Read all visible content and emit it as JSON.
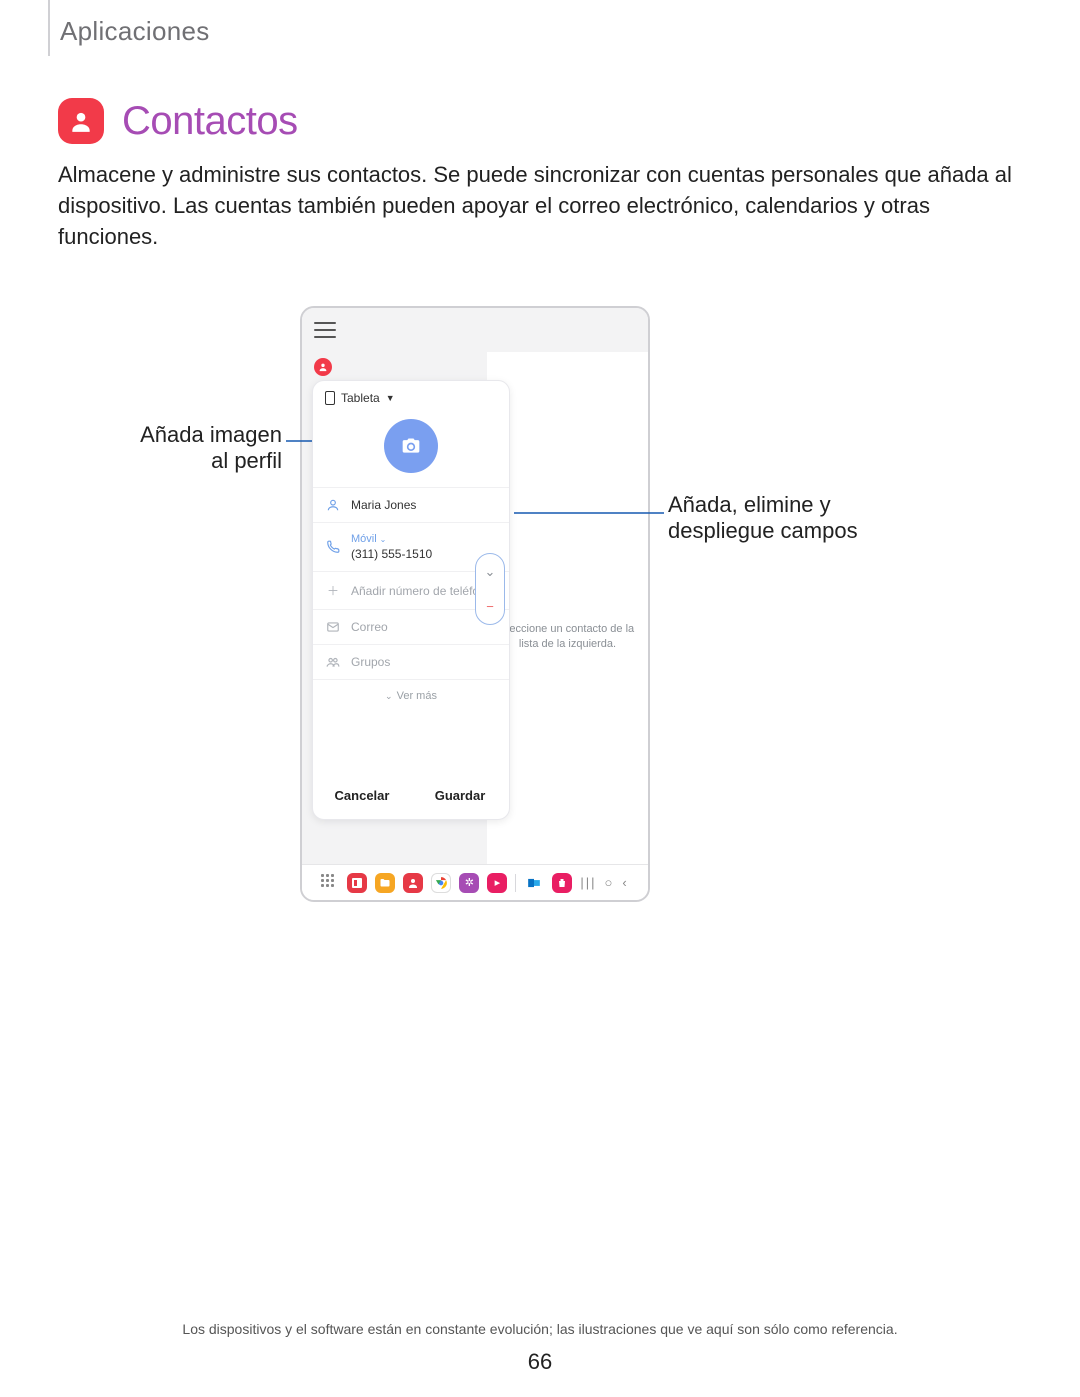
{
  "section": "Aplicaciones",
  "heading": "Contactos",
  "description": "Almacene y administre sus contactos. Se puede sincronizar con cuentas personales que añada al dispositivo. Las cuentas también pueden apoyar el correo electrónico, calendarios y otras funciones.",
  "callouts": {
    "left_line1": "Añada imagen",
    "left_line2": "al perfil",
    "right_line1": "Añada, elimine y",
    "right_line2": "despliegue campos"
  },
  "device": {
    "storage_label": "Tableta",
    "right_pane_text": "eleccione un contacto de la lista de la izquierda.",
    "contact": {
      "name": "Maria Jones",
      "phone_type": "Móvil",
      "phone_value": "(311) 555-1510",
      "add_phone": "Añadir número de teléfono",
      "email_label": "Correo",
      "groups_label": "Grupos",
      "more_label": "Ver más",
      "cancel": "Cancelar",
      "save": "Guardar"
    }
  },
  "footnote": "Los dispositivos y el software están en constante evolución; las ilustraciones que ve aquí son sólo como referencia.",
  "page_number": "66"
}
